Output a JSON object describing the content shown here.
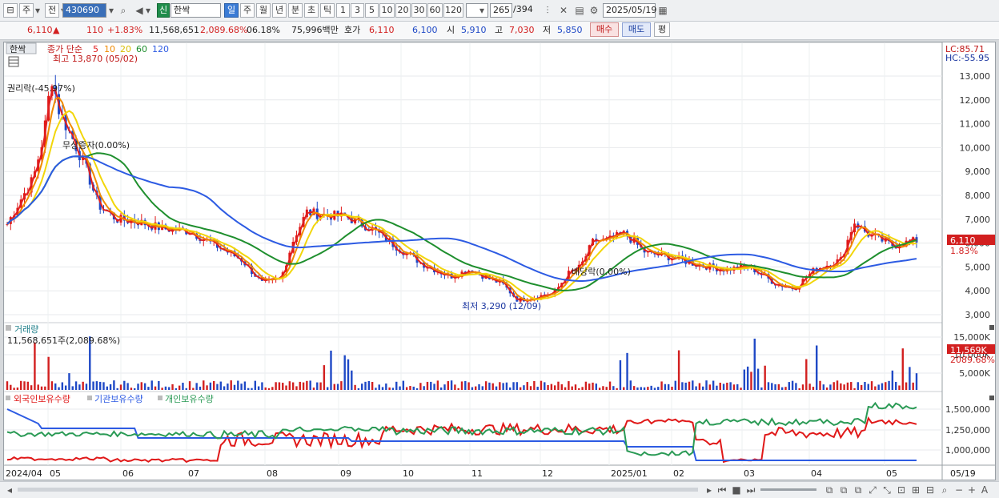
{
  "toolbar": {
    "period_main": "주",
    "prev_label": "전",
    "stock_code": "430690",
    "credit_badge": "신",
    "stock_name": "한싹",
    "periods": [
      "일",
      "주",
      "월",
      "년",
      "분",
      "초",
      "틱"
    ],
    "active_period": "일",
    "numbers": [
      "1",
      "3",
      "5",
      "10",
      "20",
      "30",
      "60",
      "120"
    ],
    "count_value": "265",
    "count_total": "/394",
    "date": "2025/05/19"
  },
  "quote": {
    "price": "6,110",
    "arrow": "▲",
    "change": "110",
    "change_pct": "+1.83%",
    "volume": "11,568,651",
    "volume_pct": "2,089.68%",
    "turnover": "06.18%",
    "amount": "75,996백만",
    "hoga_label": "호가",
    "ask": "6,110",
    "bid": "6,100",
    "open_label": "시",
    "open": "5,910",
    "high_label": "고",
    "high": "7,030",
    "low_label": "저",
    "low": "5,850",
    "buy_btn": "매수",
    "sell_btn": "매도",
    "eval_btn": "평"
  },
  "price_panel": {
    "tab": "한싹",
    "ma_label": "종가 단순",
    "ma_periods": [
      "5",
      "10",
      "20",
      "60",
      "120"
    ],
    "ma_colors": [
      "#e02020",
      "#f08a00",
      "#f2d60a",
      "#1f8f2e",
      "#2d5be3"
    ],
    "high_marker": "최고 13,870 (05/02)",
    "low_marker": "최저 3,290 (12/09)",
    "events": [
      "권리락(-45.97%)",
      "무상증자(0.00%)",
      "배당락(0.00%)"
    ],
    "lc": "LC:85.71",
    "hc": "HC:-55.95",
    "price_ticks": [
      "13,000",
      "12,000",
      "11,000",
      "10,000",
      "9,000",
      "8,000",
      "7,000",
      "6,000",
      "5,000",
      "4,000",
      "3,000"
    ],
    "current_price": "6,110",
    "current_pct": "1.83%"
  },
  "volume_panel": {
    "title": "거래량",
    "info": "11,568,651주(2,089.68%)",
    "ticks": [
      "15,000K",
      "10,000K",
      "5,000K"
    ],
    "current": "11,569K",
    "current_pct": "2089.68%"
  },
  "holding_panel": {
    "series": [
      "외국인보유수량",
      "기관보유수량",
      "개인보유수량"
    ],
    "colors": [
      "#e01818",
      "#2d5be3",
      "#2a9a55"
    ],
    "ticks": [
      "1,500,000",
      "1,250,000",
      "1,000,000"
    ]
  },
  "x_axis": [
    "2024/04",
    "05",
    "06",
    "07",
    "08",
    "09",
    "10",
    "11",
    "12",
    "2025/01",
    "02",
    "03",
    "04",
    "05"
  ],
  "x_right": "05/19"
}
